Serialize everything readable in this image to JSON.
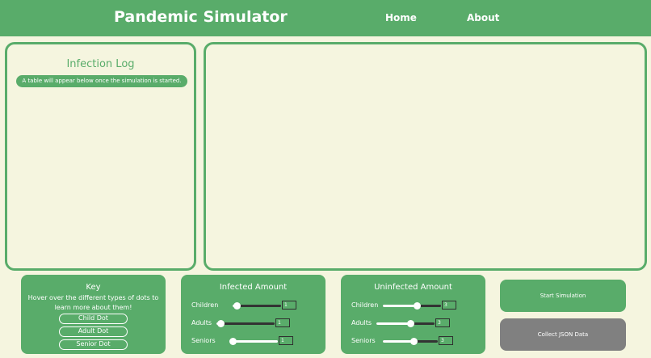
{
  "nav": {
    "title": "Pandemic Simulator",
    "home": "Home",
    "about": "About"
  },
  "infection_log": {
    "title": "Infection Log",
    "hint": "A table will appear below once the simulation is started."
  },
  "key": {
    "title": "Key",
    "description": "Hover over the different types of dots to learn more about them!",
    "dots": [
      "Child Dot",
      "Adult Dot",
      "Senior Dot"
    ]
  },
  "infected": {
    "title": "Infected Amount",
    "rows": [
      {
        "label": "Children",
        "value": "1"
      },
      {
        "label": "Adults",
        "value": "1"
      },
      {
        "label": "Seniors",
        "value": "1"
      }
    ]
  },
  "uninfected": {
    "title": "Uninfected Amount",
    "rows": [
      {
        "label": "Children",
        "value": "3"
      },
      {
        "label": "Adults",
        "value": "3"
      },
      {
        "label": "Seniors",
        "value": "3"
      }
    ]
  },
  "buttons": {
    "start": "Start Simulation",
    "json": "Collect JSON Data"
  },
  "colors": {
    "accent": "#59ac6a",
    "background": "#f5f5df",
    "disabled_button": "#808080"
  }
}
